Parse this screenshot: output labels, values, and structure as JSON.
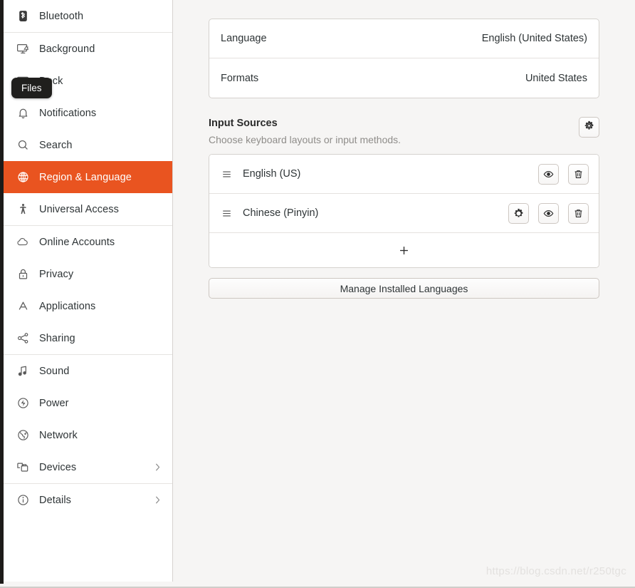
{
  "window": {
    "accent_color": "#e95420",
    "sidebar_bg": "#ffffff",
    "content_bg": "#f6f5f4"
  },
  "tooltip": {
    "label": "Files"
  },
  "sidebar": {
    "groups": [
      {
        "items": [
          {
            "label": "Bluetooth",
            "icon": "bluetooth-icon",
            "selected": false,
            "chevron": false
          }
        ]
      },
      {
        "items": [
          {
            "label": "Background",
            "icon": "background-icon",
            "selected": false,
            "chevron": false
          },
          {
            "label": "Dock",
            "icon": "dock-icon",
            "selected": false,
            "chevron": false
          },
          {
            "label": "Notifications",
            "icon": "bell-icon",
            "selected": false,
            "chevron": false
          },
          {
            "label": "Search",
            "icon": "search-icon",
            "selected": false,
            "chevron": false
          },
          {
            "label": "Region & Language",
            "icon": "globe-icon",
            "selected": true,
            "chevron": false
          },
          {
            "label": "Universal Access",
            "icon": "accessibility-icon",
            "selected": false,
            "chevron": false
          }
        ]
      },
      {
        "items": [
          {
            "label": "Online Accounts",
            "icon": "cloud-icon",
            "selected": false,
            "chevron": false
          },
          {
            "label": "Privacy",
            "icon": "lock-icon",
            "selected": false,
            "chevron": false
          },
          {
            "label": "Applications",
            "icon": "applications-icon",
            "selected": false,
            "chevron": false
          },
          {
            "label": "Sharing",
            "icon": "share-icon",
            "selected": false,
            "chevron": false
          }
        ]
      },
      {
        "items": [
          {
            "label": "Sound",
            "icon": "music-note-icon",
            "selected": false,
            "chevron": false
          },
          {
            "label": "Power",
            "icon": "power-icon",
            "selected": false,
            "chevron": false
          },
          {
            "label": "Network",
            "icon": "network-globe-icon",
            "selected": false,
            "chevron": false
          },
          {
            "label": "Devices",
            "icon": "devices-icon",
            "selected": false,
            "chevron": true
          }
        ]
      },
      {
        "items": [
          {
            "label": "Details",
            "icon": "info-icon",
            "selected": false,
            "chevron": true
          }
        ]
      }
    ]
  },
  "main": {
    "settings_rows": [
      {
        "key": "Language",
        "value": "English (United States)"
      },
      {
        "key": "Formats",
        "value": "United States"
      }
    ],
    "input_sources": {
      "title": "Input Sources",
      "subtitle": "Choose keyboard layouts or input methods.",
      "settings_button_icon": "gear-icon",
      "items": [
        {
          "name": "English (US)",
          "handle_icon": "drag-handle-icon",
          "actions": [
            {
              "icon": "eye-icon",
              "name": "preview-layout-button"
            },
            {
              "icon": "trash-icon",
              "name": "remove-source-button"
            }
          ]
        },
        {
          "name": "Chinese (Pinyin)",
          "handle_icon": "drag-handle-icon",
          "actions": [
            {
              "icon": "gear-icon",
              "name": "source-preferences-button"
            },
            {
              "icon": "eye-icon",
              "name": "preview-layout-button"
            },
            {
              "icon": "trash-icon",
              "name": "remove-source-button"
            }
          ]
        }
      ],
      "add_button_icon": "plus-icon"
    },
    "manage_button_label": "Manage Installed Languages"
  },
  "watermark": {
    "text": "https://blog.csdn.net/r250tgc"
  }
}
